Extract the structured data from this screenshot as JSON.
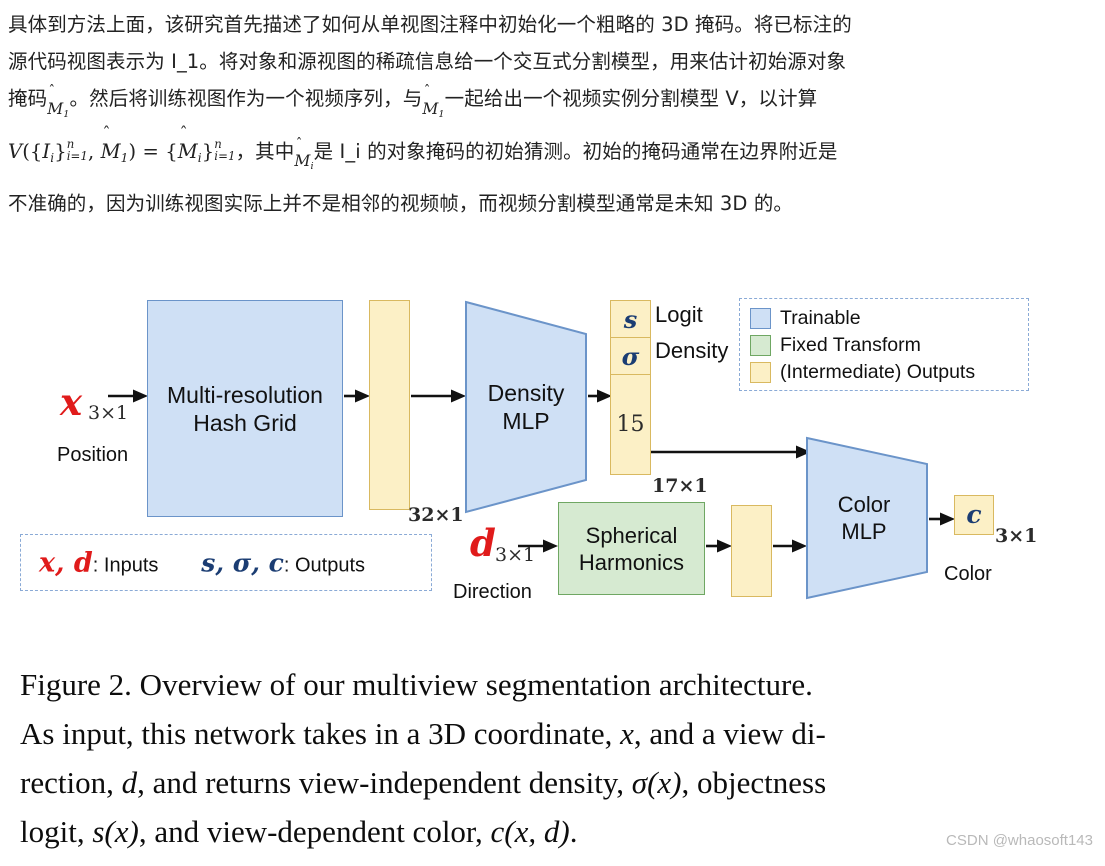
{
  "article": {
    "line1_a": "具体到方法上面，该研究首先描述了如何从单视图注释中初始化一个粗略的 3D 掩码。将已标注的",
    "line2_a": "源代码视图表示为 I_1。将对象和源视图的稀疏信息给一个交互式分割模型，用来估计初始源对象",
    "line3_a": "掩码",
    "line3_math1": "M̂₁",
    "line3_b": "。然后将训练视图作为一个视频序列，与",
    "line3_math2": "M̂₁",
    "line3_c": "一起给出一个视频实例分割模型 V，以计算",
    "line4_formula": "V({Iᵢ}ⁿᵢ₌₁, M̂₁) = {M̂ᵢ}ⁿᵢ₌₁",
    "line4_a": "，其中",
    "line4_math": "M̂ᵢ",
    "line4_b": "是 I_i 的对象掩码的初始猜测。初始的掩码通常在边界附近是",
    "line5_a": "不准确的，因为训练视图实际上并不是相邻的视频帧，而视频分割模型通常是未知 3D 的。"
  },
  "figure": {
    "input_position": {
      "symbol": "x",
      "dim": "3×1",
      "label": "Position"
    },
    "input_direction": {
      "symbol": "d",
      "dim": "3×1",
      "label": "Direction"
    },
    "hash_grid": {
      "line1": "Multi-resolution",
      "line2": "Hash Grid"
    },
    "feature_vector_32": {
      "dim": "32×1"
    },
    "density_mlp": {
      "line1": "Density",
      "line2": "MLP"
    },
    "output_stack": {
      "logit_symbol": "s",
      "logit_label": "Logit",
      "density_symbol": "σ",
      "density_label": "Density",
      "rest_value": "15",
      "dim": "17×1"
    },
    "spherical_harmonics": {
      "line1": "Spherical",
      "line2": "Harmonics"
    },
    "color_mlp": {
      "line1": "Color",
      "line2": "MLP"
    },
    "color_output": {
      "symbol": "c",
      "dim": "3×1",
      "label": "Color"
    },
    "legend_types": {
      "items": [
        {
          "label": "Trainable",
          "color": "#cfe0f5",
          "border": "#6b94c9"
        },
        {
          "label": "Fixed Transform",
          "color": "#d6ead1",
          "border": "#6fa763"
        },
        {
          "label": "(Intermediate) Outputs",
          "color": "#fcf0c6",
          "border": "#d9b960"
        }
      ]
    },
    "legend_io": {
      "inputs_symbols": "x, d",
      "inputs_sep": ": ",
      "inputs_label": "Inputs",
      "outputs_symbols": "s, σ, c",
      "outputs_sep": ": ",
      "outputs_label": "Outputs"
    },
    "colors": {
      "trainable_fill": "#cfe0f5",
      "trainable_stroke": "#6b94c9",
      "fixed_fill": "#d6ead1",
      "fixed_stroke": "#6fa763",
      "output_fill": "#fcf0c6",
      "output_stroke": "#d9b960",
      "input_red": "#e01b1b",
      "output_navy": "#1b3d73",
      "dash_border": "#8aaad6"
    }
  },
  "caption": {
    "l1": "Figure 2.  Overview of our multiview segmentation architecture.",
    "l2a": "As input, this network takes in a 3D coordinate, ",
    "l2b": "x",
    "l2c": ", and a view di-",
    "l3a": "rection, ",
    "l3b": "d",
    "l3c": ", and returns view-independent density, ",
    "l3d": "σ(x)",
    "l3e": ", objectness",
    "l4a": "logit, ",
    "l4b": "s(x)",
    "l4c": ", and view-dependent color, ",
    "l4d": "c(x, d)",
    "l4e": "."
  },
  "watermark": {
    "text": "CSDN @whaosoft143"
  }
}
